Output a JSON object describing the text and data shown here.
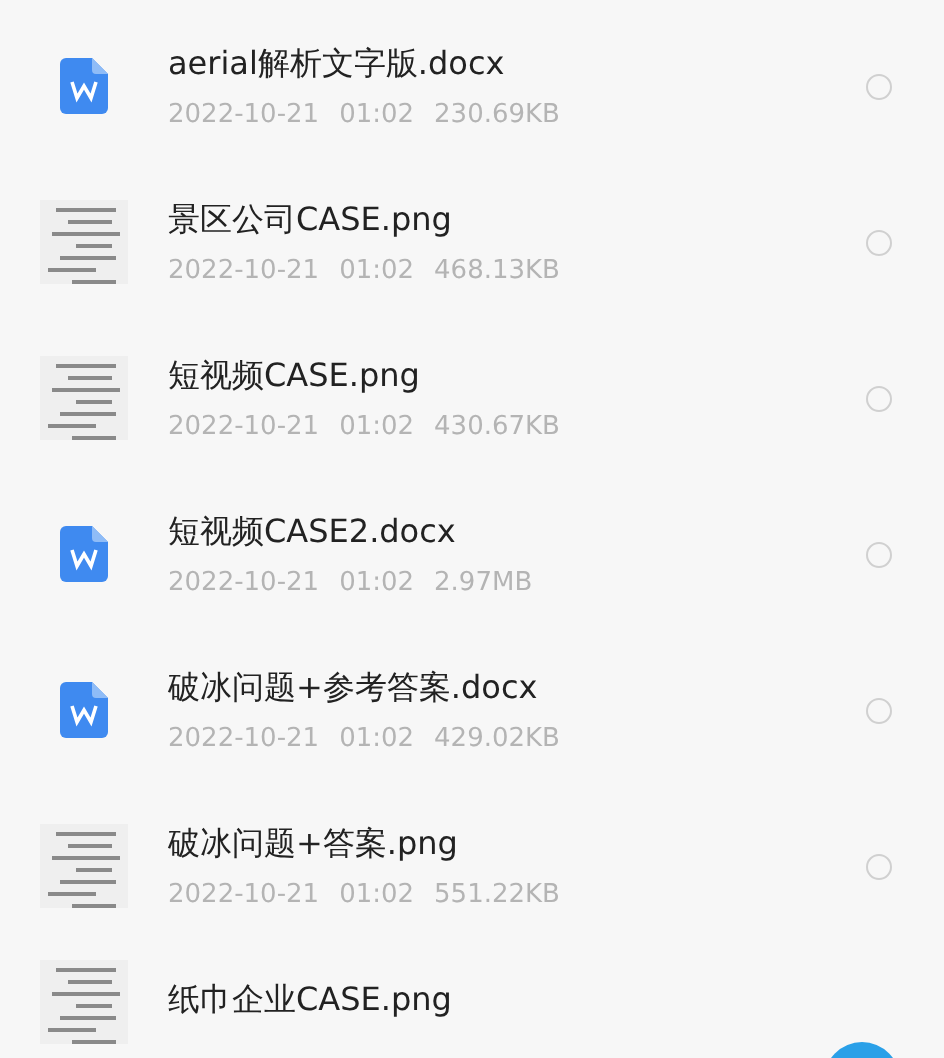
{
  "files": [
    {
      "kind": "docx",
      "name": "aerial解析文字版.docx",
      "date": "2022-10-21",
      "time": "01:02",
      "size": "230.69KB",
      "selected": false
    },
    {
      "kind": "image",
      "name": "景区公司CASE.png",
      "date": "2022-10-21",
      "time": "01:02",
      "size": "468.13KB",
      "selected": false
    },
    {
      "kind": "image",
      "name": "短视频CASE.png",
      "date": "2022-10-21",
      "time": "01:02",
      "size": "430.67KB",
      "selected": false
    },
    {
      "kind": "docx",
      "name": "短视频CASE2.docx",
      "date": "2022-10-21",
      "time": "01:02",
      "size": "2.97MB",
      "selected": false
    },
    {
      "kind": "docx",
      "name": "破冰问题+参考答案.docx",
      "date": "2022-10-21",
      "time": "01:02",
      "size": "429.02KB",
      "selected": false
    },
    {
      "kind": "image",
      "name": "破冰问题+答案.png",
      "date": "2022-10-21",
      "time": "01:02",
      "size": "551.22KB",
      "selected": false
    },
    {
      "kind": "image",
      "name": "纸巾企业CASE.png"
    }
  ]
}
